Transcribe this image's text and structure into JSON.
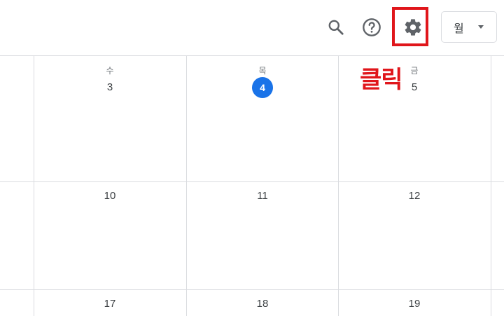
{
  "toolbar": {
    "search_icon": "search-icon",
    "help_icon": "help-icon",
    "settings_icon": "gear-icon",
    "view_select": {
      "selected": "월"
    }
  },
  "annotation": {
    "text": "클릭",
    "color": "#e0161b"
  },
  "calendar": {
    "week1": {
      "wed": {
        "day_name": "수",
        "date": "3"
      },
      "thu": {
        "day_name": "목",
        "date": "4"
      },
      "fri": {
        "day_name": "금",
        "date": "5"
      }
    },
    "week2": {
      "wed": "10",
      "thu": "11",
      "fri": "12"
    },
    "week3": {
      "wed": "17",
      "thu": "18",
      "fri": "19"
    },
    "today_color": "#1a73e8"
  }
}
